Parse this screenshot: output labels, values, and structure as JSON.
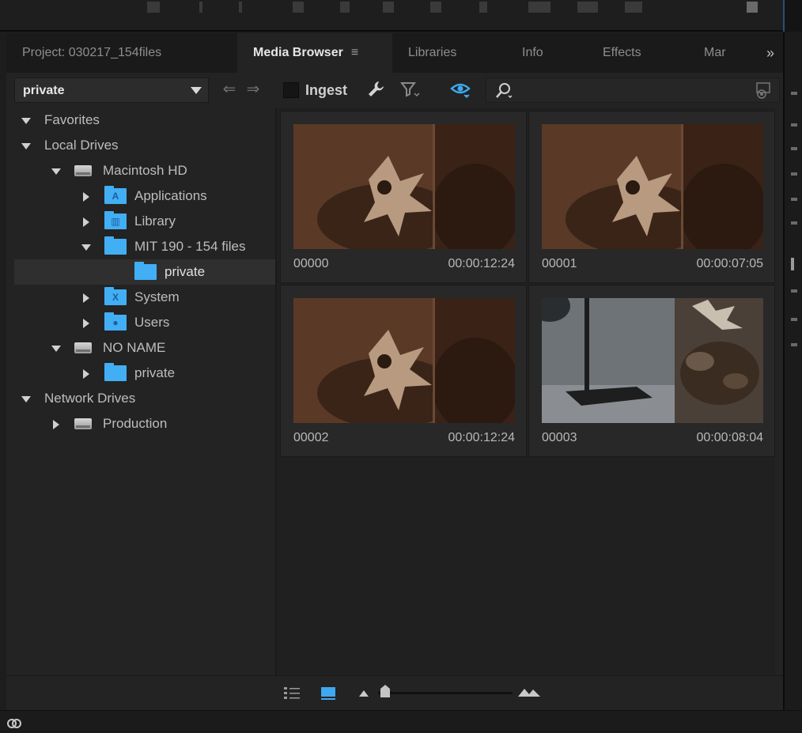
{
  "tabs": [
    {
      "label": "Project: 030217_154files",
      "active": false
    },
    {
      "label": "Media Browser",
      "active": true,
      "menu_icon": "≡"
    },
    {
      "label": "Libraries",
      "active": false
    },
    {
      "label": "Info",
      "active": false
    },
    {
      "label": "Effects",
      "active": false
    },
    {
      "label": "Mar",
      "active": false
    }
  ],
  "tab_overflow": "»",
  "toolbar": {
    "location": "private",
    "back_arrow": "⇐",
    "forward_arrow": "⇒",
    "ingest_label": "Ingest",
    "ingest_checked": false,
    "icons": [
      "wrench-icon",
      "filter-icon",
      "view-icon",
      "search-icon",
      "settings-icon"
    ]
  },
  "tree": [
    {
      "label": "Favorites",
      "expanded": true
    },
    {
      "label": "Local Drives",
      "expanded": true
    },
    {
      "label": "Macintosh HD",
      "expanded": true,
      "icon": "drive"
    },
    {
      "label": "Applications",
      "expanded": false,
      "icon": "applications-folder"
    },
    {
      "label": "Library",
      "expanded": false,
      "icon": "library-folder"
    },
    {
      "label": "MIT 190 - 154 files",
      "expanded": true,
      "icon": "folder"
    },
    {
      "label": "private",
      "icon": "folder",
      "selected": true
    },
    {
      "label": "System",
      "expanded": false,
      "icon": "system-folder"
    },
    {
      "label": "Users",
      "expanded": false,
      "icon": "users-folder"
    },
    {
      "label": "NO NAME",
      "expanded": true,
      "icon": "drive"
    },
    {
      "label": "private",
      "expanded": false,
      "icon": "folder"
    },
    {
      "label": "Network Drives",
      "expanded": true
    },
    {
      "label": "Production",
      "expanded": false,
      "icon": "drive"
    }
  ],
  "clips": [
    {
      "name": "00000",
      "duration": "00:00:12:24"
    },
    {
      "name": "00001",
      "duration": "00:00:07:05"
    },
    {
      "name": "00002",
      "duration": "00:00:12:24"
    },
    {
      "name": "00003",
      "duration": "00:00:08:04"
    }
  ],
  "bottom": {
    "view_mode": "thumbnail",
    "zoom_level": 0.05
  },
  "colors": {
    "accent": "#42aef3",
    "panel_bg": "#232323"
  }
}
